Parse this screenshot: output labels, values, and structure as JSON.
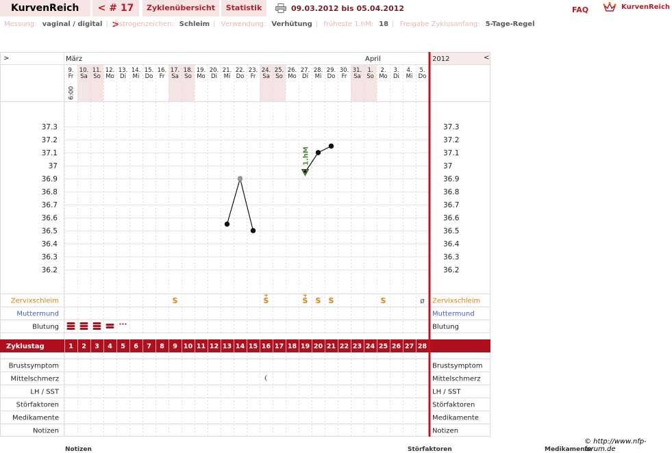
{
  "header": {
    "brand": "KurvenReich",
    "cycle_nav": "< # 17 >",
    "tab_cycles": "Zyklenübersicht",
    "tab_stats": "Statistik",
    "date_range": "09.03.2012 bis 05.04.2012",
    "faq": "FAQ",
    "logo_text": "KurvenReich"
  },
  "settings": [
    {
      "key": "Messung:",
      "value": "vaginal / digital"
    },
    {
      "key": "Östrogenzeichen:",
      "value": "Schleim"
    },
    {
      "key": "Verwendung:",
      "value": "Verhütung"
    },
    {
      "key": "früheste 1.hM:",
      "value": "18"
    },
    {
      "key": "Freigabe Zyklusanfang:",
      "value": "5-Tage-Regel"
    }
  ],
  "footer": {
    "credit": "© http://www.nfp-forum.de",
    "hints": [
      "Notizen",
      "Störfaktoren",
      "Medikamente"
    ]
  },
  "colors": {
    "accent": "#b0101e",
    "brand_bg": "#f5e4e4",
    "weekend_bg": "#f5e4e4",
    "mucus": "#e08010",
    "cervix": "#4a5cc9"
  },
  "chart_data": {
    "type": "line",
    "title": "",
    "year": "2012",
    "nav_left": ">",
    "nav_right": "<",
    "months": [
      {
        "label": "März",
        "day_index": 0
      },
      {
        "label": "April",
        "day_index": 23
      }
    ],
    "measure_time": "6:00",
    "days": [
      {
        "date": "9.",
        "wd": "Fr"
      },
      {
        "date": "10.",
        "wd": "Sa"
      },
      {
        "date": "11.",
        "wd": "So"
      },
      {
        "date": "12.",
        "wd": "Mo"
      },
      {
        "date": "13.",
        "wd": "Di"
      },
      {
        "date": "14.",
        "wd": "Mi"
      },
      {
        "date": "15.",
        "wd": "Do"
      },
      {
        "date": "16.",
        "wd": "Fr"
      },
      {
        "date": "17.",
        "wd": "Sa"
      },
      {
        "date": "18.",
        "wd": "So"
      },
      {
        "date": "19.",
        "wd": "Mo"
      },
      {
        "date": "20.",
        "wd": "Di"
      },
      {
        "date": "21.",
        "wd": "Mi"
      },
      {
        "date": "22.",
        "wd": "Do"
      },
      {
        "date": "23.",
        "wd": "Fr"
      },
      {
        "date": "24.",
        "wd": "Sa"
      },
      {
        "date": "25.",
        "wd": "So"
      },
      {
        "date": "26.",
        "wd": "Mo"
      },
      {
        "date": "27.",
        "wd": "Di"
      },
      {
        "date": "28.",
        "wd": "Mi"
      },
      {
        "date": "29.",
        "wd": "Do"
      },
      {
        "date": "30.",
        "wd": "Fr"
      },
      {
        "date": "31.",
        "wd": "Sa"
      },
      {
        "date": "1.",
        "wd": "So"
      },
      {
        "date": "2.",
        "wd": "Mo"
      },
      {
        "date": "3.",
        "wd": "Di"
      },
      {
        "date": "4.",
        "wd": "Mi"
      },
      {
        "date": "5.",
        "wd": "Do"
      }
    ],
    "weekend_indices": [
      1,
      2,
      8,
      9,
      15,
      16,
      22,
      23
    ],
    "y_ticks": [
      "37.3",
      "37.2",
      "37.1",
      "37",
      "36.9",
      "36.8",
      "36.7",
      "36.6",
      "36.5",
      "36.4",
      "36.3",
      "36.2"
    ],
    "ylim": [
      36.1,
      37.4
    ],
    "temperature_segments": [
      {
        "points": [
          {
            "cycle_day": 13,
            "temp": 36.55,
            "excluded": false
          },
          {
            "cycle_day": 14,
            "temp": 36.9,
            "excluded": true
          },
          {
            "cycle_day": 15,
            "temp": 36.5,
            "excluded": false
          }
        ]
      },
      {
        "points": [
          {
            "cycle_day": 19,
            "temp": 36.95,
            "excluded": false,
            "marker": "triangle"
          },
          {
            "cycle_day": 20,
            "temp": 37.1,
            "excluded": false
          },
          {
            "cycle_day": 21,
            "temp": 37.15,
            "excluded": false
          }
        ]
      }
    ],
    "first_higher_label": "1.hM",
    "first_higher_day": 19,
    "rows": {
      "mucus": {
        "label": "Zervixschleim",
        "entries": [
          {
            "cycle_day": 9,
            "symbol": "S"
          },
          {
            "cycle_day": 16,
            "symbol": "S+"
          },
          {
            "cycle_day": 19,
            "symbol": "S+"
          },
          {
            "cycle_day": 20,
            "symbol": "S"
          },
          {
            "cycle_day": 21,
            "symbol": "S"
          },
          {
            "cycle_day": 25,
            "symbol": "S"
          },
          {
            "cycle_day": 28,
            "symbol": "ø"
          }
        ]
      },
      "cervix": {
        "label": "Muttermund"
      },
      "bleeding": {
        "label": "Blutung",
        "entries": [
          {
            "cycle_day": 1,
            "level": "strong"
          },
          {
            "cycle_day": 2,
            "level": "strong"
          },
          {
            "cycle_day": 3,
            "level": "strong"
          },
          {
            "cycle_day": 4,
            "level": "medium"
          },
          {
            "cycle_day": 5,
            "level": "spotting"
          }
        ]
      },
      "cycle_day": {
        "label": "Zyklustag",
        "count": 28
      },
      "breast": {
        "label": "Brustsymptom"
      },
      "midpain": {
        "label": "Mittelschmerz",
        "entries": [
          {
            "cycle_day": 16,
            "symbol": "moon"
          }
        ]
      },
      "lh": {
        "label": "LH / SST"
      },
      "disturb": {
        "label": "Störfaktoren"
      },
      "meds": {
        "label": "Medikamente"
      },
      "notes": {
        "label": "Notizen"
      }
    }
  }
}
